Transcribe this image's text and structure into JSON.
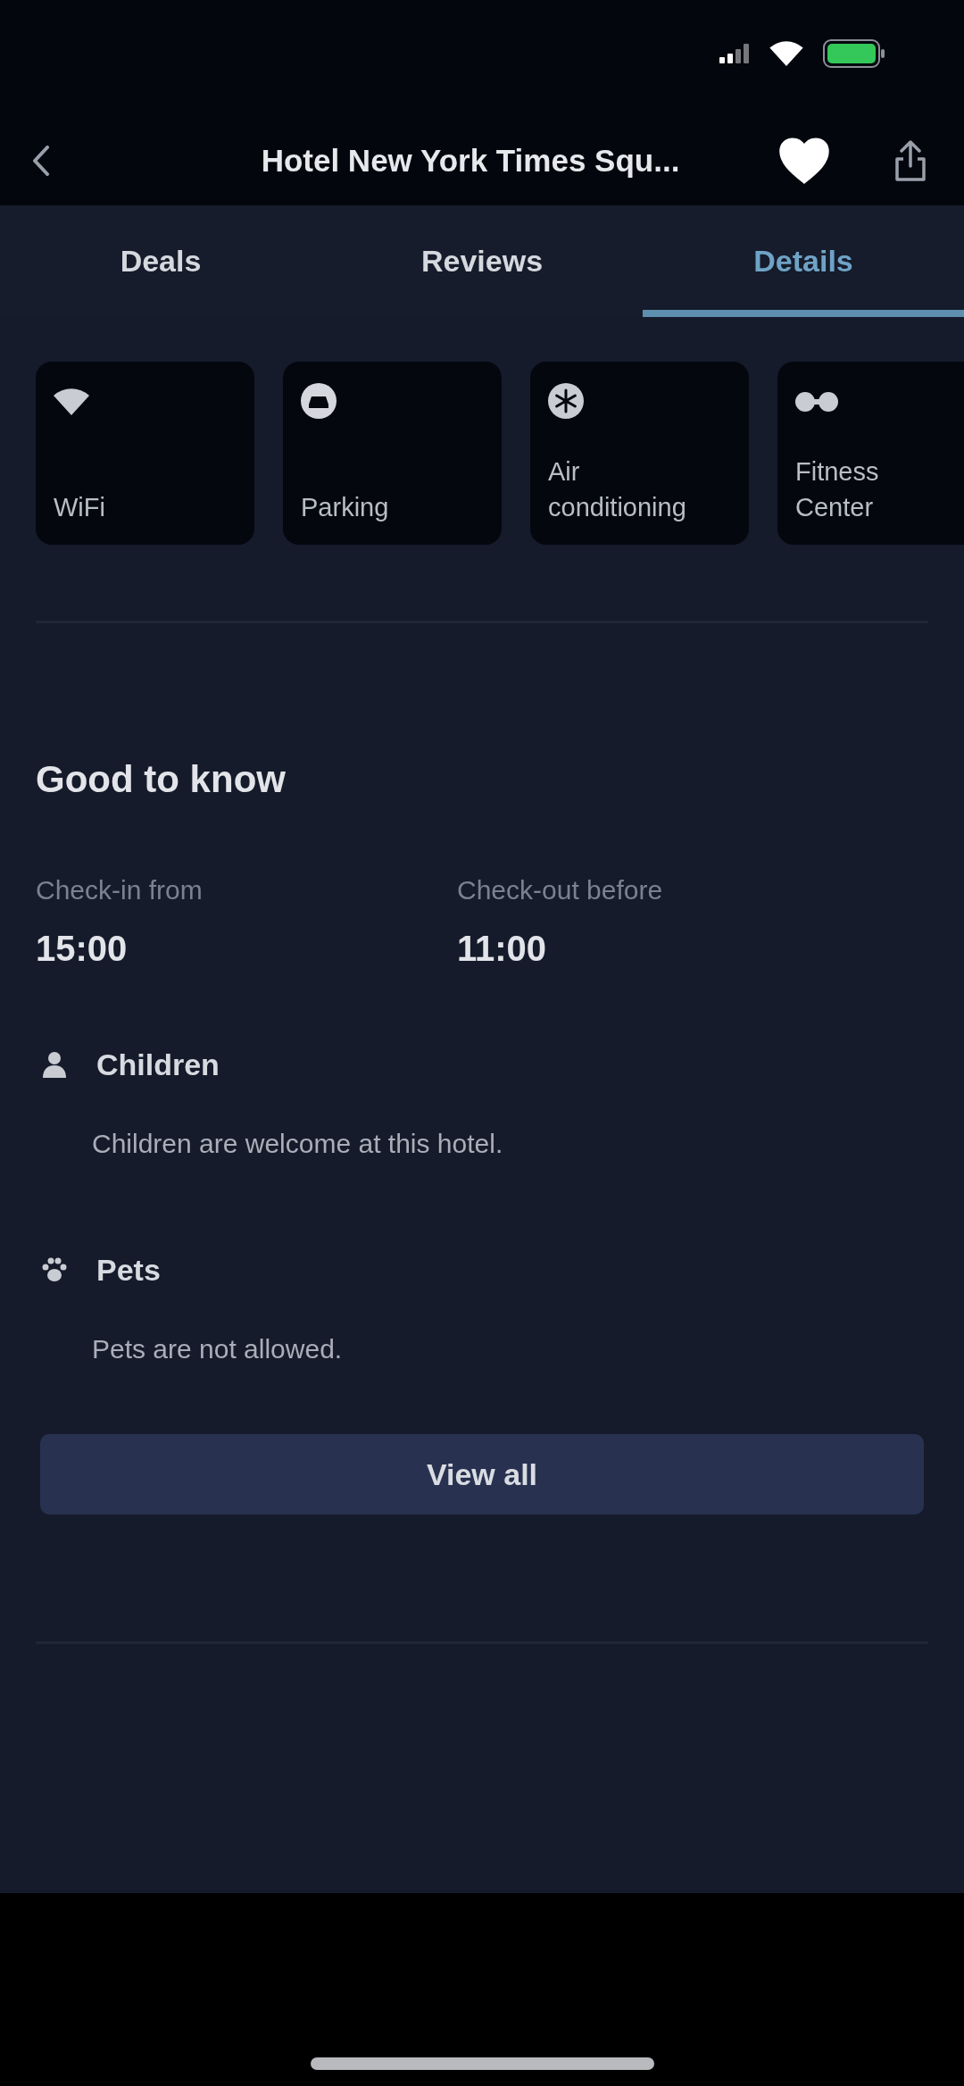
{
  "header": {
    "title": "Hotel New York Times Squ...",
    "favorited": true
  },
  "tabs": [
    {
      "label": "Deals",
      "selected": false
    },
    {
      "label": "Reviews",
      "selected": false
    },
    {
      "label": "Details",
      "selected": true
    }
  ],
  "amenities": [
    {
      "kind": "wifi",
      "label": "WiFi"
    },
    {
      "kind": "parking",
      "label": "Parking"
    },
    {
      "kind": "air_conditioning",
      "label": "Air conditioning"
    },
    {
      "kind": "fitness",
      "label": "Fitness Center"
    }
  ],
  "good_to_know": {
    "title": "Good to know",
    "times": [
      {
        "label": "Check-in from",
        "value": "15:00"
      },
      {
        "label": "Check-out before",
        "value": "11:00"
      }
    ],
    "policies": [
      {
        "kind": "children",
        "title": "Children",
        "text": "Children are welcome at this hotel."
      },
      {
        "kind": "pets",
        "title": "Pets",
        "text": "Pets are not allowed."
      }
    ],
    "button": "View all"
  }
}
